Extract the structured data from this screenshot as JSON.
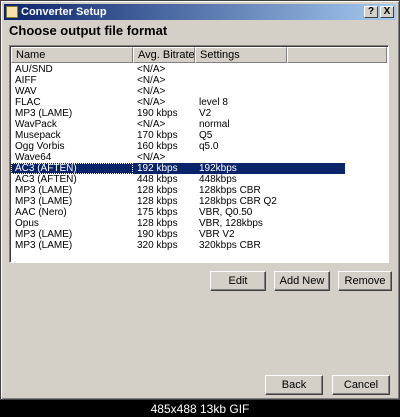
{
  "window": {
    "title": "Converter Setup",
    "help_label": "?",
    "close_label": "X"
  },
  "heading": "Choose output file format",
  "columns": [
    "Name",
    "Avg. Bitrate",
    "Settings",
    ""
  ],
  "rows": [
    {
      "name": "AU/SND",
      "bitrate": "<N/A>",
      "settings": ""
    },
    {
      "name": "AIFF",
      "bitrate": "<N/A>",
      "settings": ""
    },
    {
      "name": "WAV",
      "bitrate": "<N/A>",
      "settings": ""
    },
    {
      "name": "FLAC",
      "bitrate": "<N/A>",
      "settings": "level 8"
    },
    {
      "name": "MP3 (LAME)",
      "bitrate": "190 kbps",
      "settings": "V2"
    },
    {
      "name": "WavPack",
      "bitrate": "<N/A>",
      "settings": "normal"
    },
    {
      "name": "Musepack",
      "bitrate": "170 kbps",
      "settings": "Q5"
    },
    {
      "name": "Ogg Vorbis",
      "bitrate": "160 kbps",
      "settings": "q5.0"
    },
    {
      "name": "Wave64",
      "bitrate": "<N/A>",
      "settings": ""
    },
    {
      "name": "AC3 (AFTEN)",
      "bitrate": "192 kbps",
      "settings": "192kbps",
      "selected": true
    },
    {
      "name": "AC3 (AFTEN)",
      "bitrate": "448 kbps",
      "settings": "448kbps"
    },
    {
      "name": "MP3 (LAME)",
      "bitrate": "128 kbps",
      "settings": "128kbps CBR"
    },
    {
      "name": "MP3 (LAME)",
      "bitrate": "128 kbps",
      "settings": "128kbps CBR Q2"
    },
    {
      "name": "AAC (Nero)",
      "bitrate": "175 kbps",
      "settings": "VBR, Q0.50"
    },
    {
      "name": "Opus",
      "bitrate": "128 kbps",
      "settings": "VBR, 128kbps"
    },
    {
      "name": "MP3 (LAME)",
      "bitrate": "190 kbps",
      "settings": "VBR V2"
    },
    {
      "name": "MP3 (LAME)",
      "bitrate": "320 kbps",
      "settings": "320kbps CBR"
    }
  ],
  "buttons": {
    "edit": "Edit",
    "add_new": "Add New",
    "remove": "Remove",
    "back": "Back",
    "cancel": "Cancel"
  },
  "footer": "485x488 13kb GIF"
}
